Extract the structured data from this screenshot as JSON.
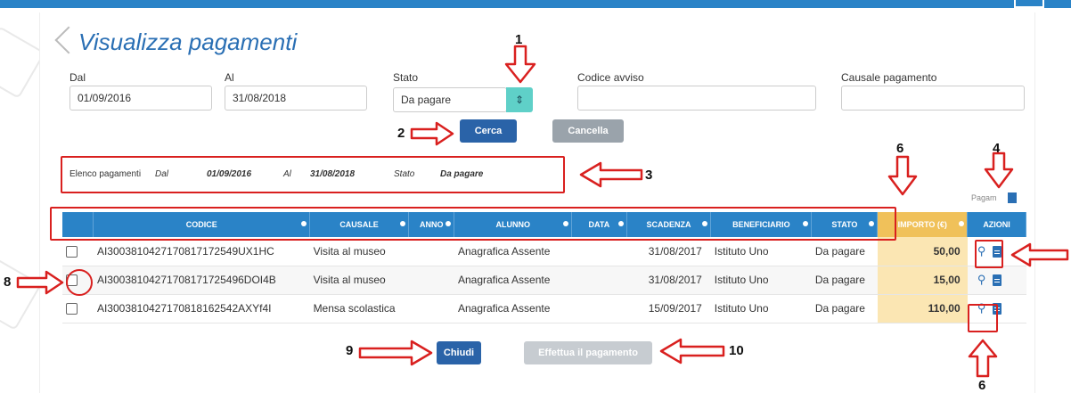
{
  "page": {
    "title": "Visualizza pagamenti"
  },
  "form": {
    "dal_label": "Dal",
    "dal_value": "01/09/2016",
    "al_label": "Al",
    "al_value": "31/08/2018",
    "stato_label": "Stato",
    "stato_value": "Da pagare",
    "codice_label": "Codice avviso",
    "codice_value": "",
    "causale_label": "Causale pagamento",
    "causale_value": ""
  },
  "buttons": {
    "cerca": "Cerca",
    "cancella": "Cancella",
    "chiudi": "Chiudi",
    "effettua": "Effettua il pagamento"
  },
  "summary": {
    "label": "Elenco pagamenti",
    "dal_label": "Dal",
    "dal_value": "01/09/2016",
    "al_label": "Al",
    "al_value": "31/08/2018",
    "stato_label": "Stato",
    "stato_value": "Da pagare"
  },
  "hint": {
    "label": "Pagam"
  },
  "table": {
    "headers": [
      "CODICE",
      "CAUSALE",
      "ANNO",
      "ALUNNO",
      "DATA",
      "SCADENZA",
      "BENEFICIARIO",
      "STATO",
      "IMPORTO (€)",
      "AZIONI"
    ],
    "rows": [
      {
        "codice": "AI3003810427170817172549UX1HC",
        "causale": "Visita al museo",
        "anno": "",
        "alunno": "Anagrafica Assente",
        "data": "",
        "scadenza": "31/08/2017",
        "beneficiario": "Istituto Uno",
        "stato": "Da pagare",
        "importo": "50,00"
      },
      {
        "codice": "AI30038104271708171725496DOI4B",
        "causale": "Visita al museo",
        "anno": "",
        "alunno": "Anagrafica Assente",
        "data": "",
        "scadenza": "31/08/2017",
        "beneficiario": "Istituto Uno",
        "stato": "Da pagare",
        "importo": "15,00"
      },
      {
        "codice": "AI3003810427170818162542AXYf4I",
        "causale": "Mensa scolastica",
        "anno": "",
        "alunno": "Anagrafica Assente",
        "data": "",
        "scadenza": "15/09/2017",
        "beneficiario": "Istituto Uno",
        "stato": "Da pagare",
        "importo": "110,00"
      }
    ]
  },
  "annotations": {
    "n1": "1",
    "n2": "2",
    "n3": "3",
    "n4": "4",
    "n6a": "6",
    "n6b": "6",
    "n8": "8",
    "n9": "9",
    "n10": "10"
  },
  "colors": {
    "header_blue": "#2a83c7",
    "title_blue": "#2a6fb4",
    "importo_highlight": "#f0c15a",
    "annotation_red": "#d9201f"
  },
  "icons": {
    "stato_select": "chevron-updown-icon",
    "search": "search-icon",
    "document": "document-icon"
  }
}
